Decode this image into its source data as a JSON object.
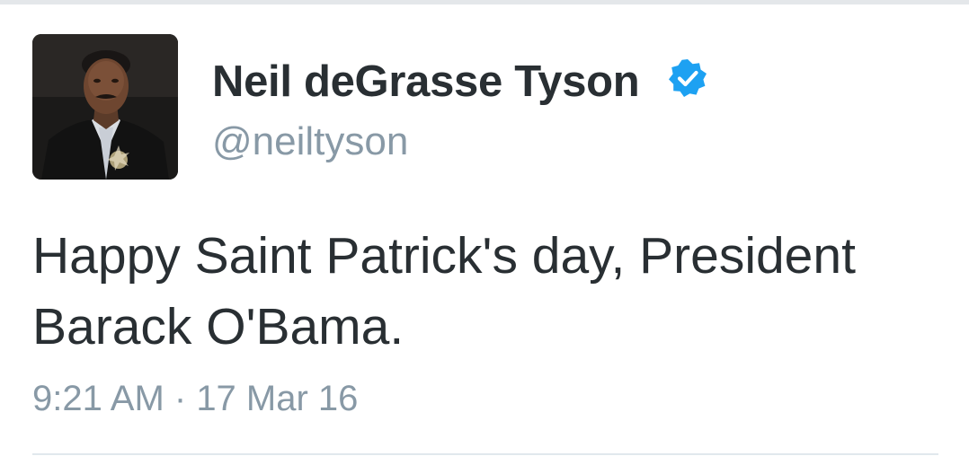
{
  "tweet": {
    "display_name": "Neil deGrasse Tyson",
    "handle": "@neiltyson",
    "verified": true,
    "text": "Happy Saint Patrick's day, President\nBarack O'Bama.",
    "time": "9:21 AM",
    "separator": " · ",
    "date": "17 Mar 16"
  },
  "icons": {
    "verified": "verified-badge-icon",
    "avatar": "profile-photo"
  },
  "colors": {
    "name_text": "#292f33",
    "secondary_text": "#8899a6",
    "verified_blue": "#1da1f2",
    "divider": "#e1e8ed"
  }
}
